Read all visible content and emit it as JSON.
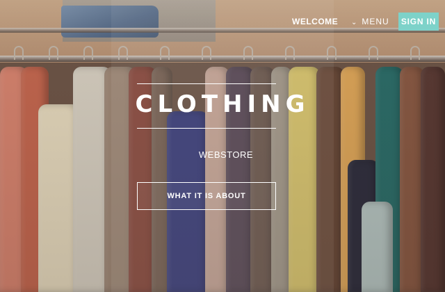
{
  "nav": {
    "welcome_label": "WELCOME",
    "menu_label": "MENU",
    "signin_label": "SIGN IN"
  },
  "hero": {
    "title": "CLOTHING",
    "subtitle": "WEBSTORE",
    "cta_label": "WHAT IT IS ABOUT"
  },
  "colors": {
    "accent": "#7dd2c9",
    "text": "#ffffff"
  },
  "icons": {
    "menu_toggle": "chevron-down-icon"
  }
}
